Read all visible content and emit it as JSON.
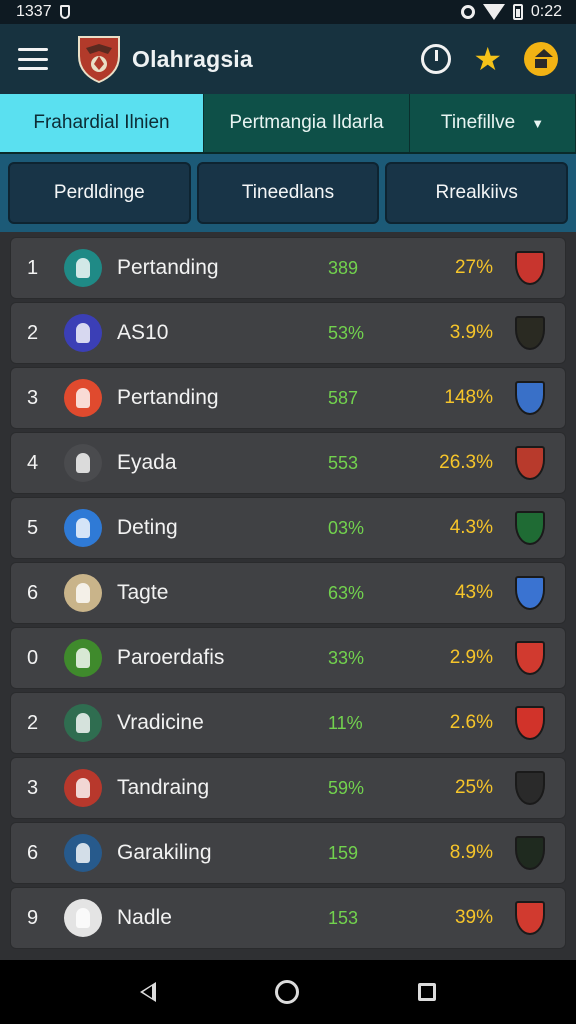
{
  "status_bar": {
    "left_time": "1337",
    "right_time": "0:22"
  },
  "header": {
    "title": "Olahragsia"
  },
  "tabs": [
    {
      "label": "Frahardial Ilnien"
    },
    {
      "label": "Pertmangia Ildarla"
    },
    {
      "label": "Tinefillve"
    }
  ],
  "filters": [
    {
      "label": "Perdldinge"
    },
    {
      "label": "Tineedlans"
    },
    {
      "label": "Rrealkiivs"
    }
  ],
  "rows": [
    {
      "rank": "1",
      "name": "Pertanding",
      "v1": "389",
      "v2": "27%",
      "avatar_color": "#1f8a86",
      "badge_color": "#c8352e"
    },
    {
      "rank": "2",
      "name": "AS10",
      "v1": "53%",
      "v2": "3.9%",
      "avatar_color": "#3b3fb6",
      "badge_color": "#2a2a22"
    },
    {
      "rank": "3",
      "name": "Pertanding",
      "v1": "587",
      "v2": "148%",
      "avatar_color": "#e04a2e",
      "badge_color": "#3970c8"
    },
    {
      "rank": "4",
      "name": "Eyada",
      "v1": "553",
      "v2": "26.3%",
      "avatar_color": "#4a4b4e",
      "badge_color": "#b83a2c"
    },
    {
      "rank": "5",
      "name": "Deting",
      "v1": "03%",
      "v2": "4.3%",
      "avatar_color": "#2f7ad6",
      "badge_color": "#1f6b34"
    },
    {
      "rank": "6",
      "name": "Tagte",
      "v1": "63%",
      "v2": "43%",
      "avatar_color": "#c9b48a",
      "badge_color": "#3a73d1"
    },
    {
      "rank": "0",
      "name": "Paroerdafis",
      "v1": "33%",
      "v2": "2.9%",
      "avatar_color": "#3f8a2c",
      "badge_color": "#d13a2f"
    },
    {
      "rank": "2",
      "name": "Vradicine",
      "v1": "11%",
      "v2": "2.6%",
      "avatar_color": "#2f6d50",
      "badge_color": "#d1332a"
    },
    {
      "rank": "3",
      "name": "Tandraing",
      "v1": "59%",
      "v2": "25%",
      "avatar_color": "#b8382c",
      "badge_color": "#2a2a2a"
    },
    {
      "rank": "6",
      "name": "Garakiling",
      "v1": "159",
      "v2": "8.9%",
      "avatar_color": "#275a8c",
      "badge_color": "#1f2a1f"
    },
    {
      "rank": "9",
      "name": "Nadle",
      "v1": "153",
      "v2": "39%",
      "avatar_color": "#e4e4e4",
      "badge_color": "#d13a2f"
    }
  ]
}
